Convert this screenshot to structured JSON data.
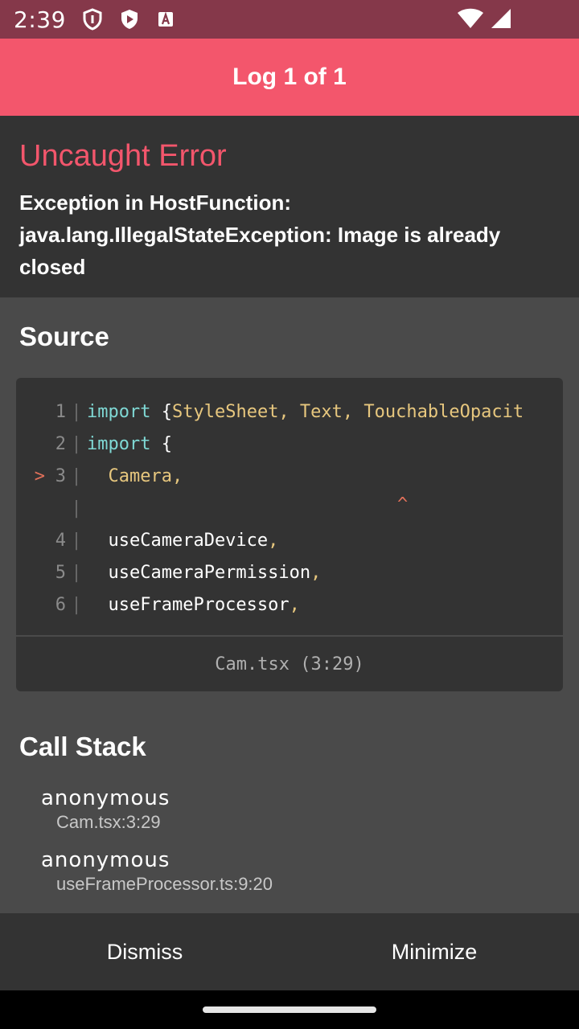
{
  "status_bar": {
    "time": "2:39",
    "icons": [
      "shield-icon",
      "play-shield-icon",
      "font-icon"
    ],
    "right_icons": [
      "wifi-icon",
      "signal-icon"
    ]
  },
  "header": {
    "title": "Log 1 of 1"
  },
  "error": {
    "title": "Uncaught Error",
    "message": "Exception in HostFunction: java.lang.IllegalStateException: Image is already closed"
  },
  "source": {
    "title": "Source",
    "lines": [
      {
        "marker": "",
        "num": "1",
        "sep": "|",
        "kw": "import",
        "punct": " {",
        "code": "StyleSheet, Text, TouchableOpacit",
        "tail": ""
      },
      {
        "marker": "",
        "num": "2",
        "sep": "|",
        "kw": "import",
        "punct": " {",
        "code": "",
        "tail": ""
      },
      {
        "marker": ">",
        "num": "3",
        "sep": "|",
        "kw": "",
        "punct": "",
        "code": "  Camera,",
        "tail": ""
      },
      {
        "marker": "",
        "num": "",
        "sep": "|",
        "kw": "",
        "punct": "",
        "code": "",
        "tail": ""
      },
      {
        "marker": "",
        "num": "4",
        "sep": "|",
        "kw": "",
        "punct": "",
        "code": "  useCameraDevice",
        "tail": ","
      },
      {
        "marker": "",
        "num": "5",
        "sep": "|",
        "kw": "",
        "punct": "",
        "code": "  useCameraPermission",
        "tail": ","
      },
      {
        "marker": "",
        "num": "6",
        "sep": "|",
        "kw": "",
        "punct": "",
        "code": "  useFrameProcessor",
        "tail": ","
      }
    ],
    "caret": "^",
    "file": "Cam.tsx (3:29)"
  },
  "call_stack": {
    "title": "Call Stack",
    "items": [
      {
        "fn": "anonymous",
        "loc": "Cam.tsx:3:29"
      },
      {
        "fn": "anonymous",
        "loc": "useFrameProcessor.ts:9:20"
      }
    ]
  },
  "footer": {
    "dismiss": "Dismiss",
    "minimize": "Minimize"
  }
}
